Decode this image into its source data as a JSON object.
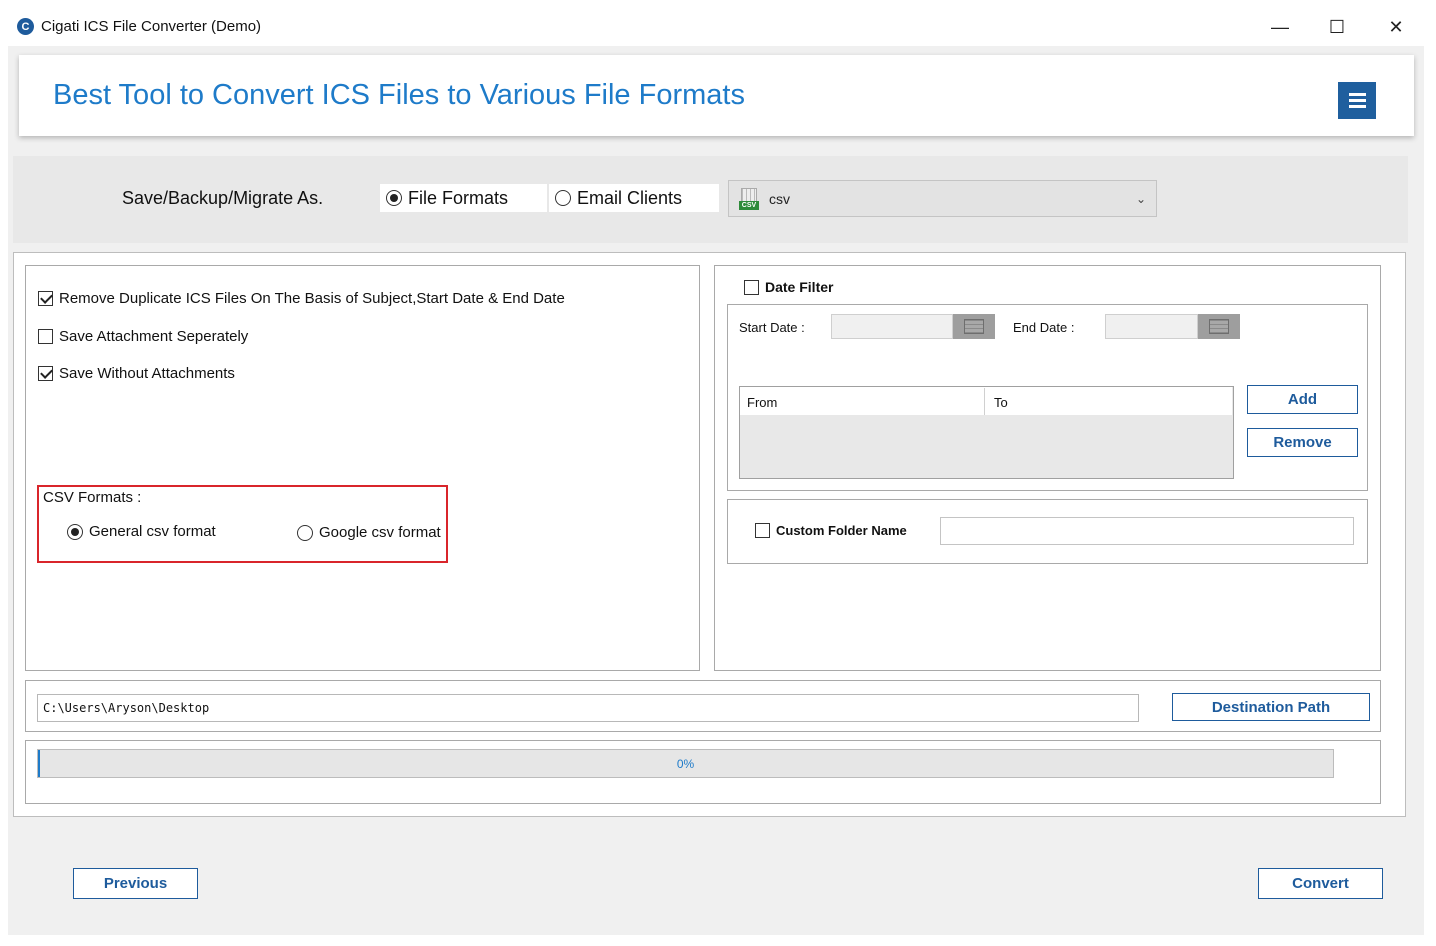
{
  "window": {
    "title": "Cigati ICS File Converter (Demo)",
    "app_icon": "cigati-logo-icon",
    "controls": [
      "minimize",
      "maximize",
      "close"
    ],
    "minimize_glyph": "—",
    "maximize_glyph": "☐",
    "close_glyph": "✕"
  },
  "header": {
    "title": "Best Tool to Convert ICS Files to Various File Formats",
    "menu_icon": "hamburger-menu-icon",
    "accent_color": "#1e7bc9",
    "menu_color": "#1f5f9e"
  },
  "save_as": {
    "label": "Save/Backup/Migrate As.",
    "options": [
      {
        "label": "File Formats",
        "selected": true
      },
      {
        "label": "Email Clients",
        "selected": false
      }
    ],
    "format_select": {
      "value": "csv",
      "icon": "csv-file-icon"
    }
  },
  "options": [
    {
      "label": "Remove Duplicate ICS Files On The Basis of Subject,Start Date & End Date",
      "checked": true
    },
    {
      "label": "Save Attachment Seperately",
      "checked": false
    },
    {
      "label": "Save Without Attachments",
      "checked": true
    }
  ],
  "csv_formats": {
    "label": "CSV Formats :",
    "options": [
      {
        "label": "General csv format",
        "selected": true
      },
      {
        "label": "Google csv format",
        "selected": false
      }
    ],
    "border_color": "#d9252b"
  },
  "date_filter": {
    "label": "Date Filter",
    "checked": false,
    "start_label": "Start Date :",
    "start_value": "",
    "end_label": "End Date :",
    "end_value": "",
    "calendar_icon": "calendar-icon",
    "columns": [
      "From",
      "To"
    ],
    "add_label": "Add",
    "remove_label": "Remove"
  },
  "custom_folder": {
    "label": "Custom Folder Name",
    "checked": false,
    "value": ""
  },
  "destination": {
    "path": "C:\\Users\\Aryson\\Desktop",
    "button_label": "Destination Path"
  },
  "progress": {
    "text": "0%",
    "value": 0
  },
  "footer": {
    "previous_label": "Previous",
    "convert_label": "Convert"
  }
}
